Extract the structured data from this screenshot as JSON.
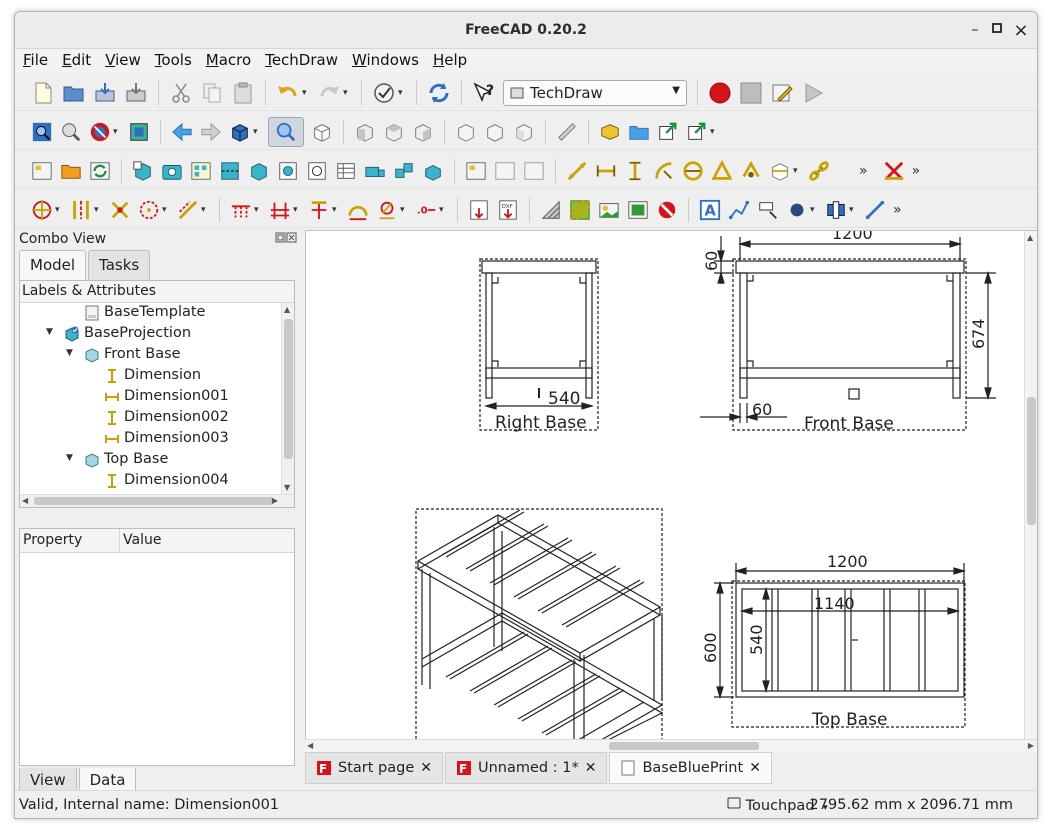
{
  "window": {
    "title": "FreeCAD 0.20.2",
    "min": "–",
    "max": "□",
    "close": "×"
  },
  "menu": [
    "File",
    "Edit",
    "View",
    "Tools",
    "Macro",
    "TechDraw",
    "Windows",
    "Help"
  ],
  "toolbar": {
    "workbench": "TechDraw"
  },
  "combo": {
    "title": "Combo View",
    "tabs": [
      "Model",
      "Tasks"
    ],
    "tree_header": "Labels & Attributes",
    "tree": [
      {
        "label": "BaseTemplate",
        "depth": 3
      },
      {
        "label": "BaseProjection",
        "depth": 2
      },
      {
        "label": "Front Base",
        "depth": 3
      },
      {
        "label": "Dimension",
        "depth": 4
      },
      {
        "label": "Dimension001",
        "depth": 4
      },
      {
        "label": "Dimension002",
        "depth": 4
      },
      {
        "label": "Dimension003",
        "depth": 4
      },
      {
        "label": "Top Base",
        "depth": 3
      },
      {
        "label": "Dimension004",
        "depth": 4
      }
    ],
    "prop_headers": [
      "Property",
      "Value"
    ],
    "bottom_tabs": [
      "View",
      "Data"
    ]
  },
  "drawing": {
    "right_base": {
      "label": "Right Base",
      "dim": "540"
    },
    "front_base": {
      "label": "Front Base",
      "dim_width": "1200",
      "dim_height": "674",
      "dim_top": "60",
      "dim_leg": "60"
    },
    "top_base": {
      "label": "Top Base",
      "dim_width": "1200",
      "dim_inner": "1140",
      "dim_depth": "600",
      "dim_inner_depth": "540"
    }
  },
  "doc_tabs": [
    "Start page",
    "Unnamed : 1*",
    "BaseBluePrint"
  ],
  "status": {
    "message": "Valid, Internal name: Dimension001",
    "nav": "Touchpad",
    "dimensions": "2795.62 mm x 2096.71 mm"
  },
  "colors": {
    "accent": "#3a6ea5",
    "dim_icon": "#c9a400",
    "record": "#d4141a"
  }
}
